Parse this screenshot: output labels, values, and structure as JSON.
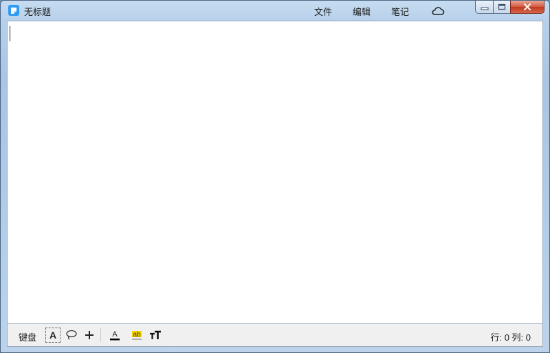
{
  "window": {
    "title": "无标题",
    "menu": {
      "file": "文件",
      "edit": "编辑",
      "notes": "笔记"
    },
    "icons": {
      "app": "note-app-icon",
      "cloud": "cloud-icon",
      "minimize": "minimize-icon",
      "maximize": "maximize-icon",
      "close": "close-icon"
    }
  },
  "editor": {
    "content": ""
  },
  "toolbar": {
    "keyboard_label": "键盘",
    "text_tool_label": "A",
    "font_color_label": "A",
    "highlight_label": "ab",
    "font_color_swatch": "#000000",
    "highlight_color": "#f5d400",
    "icons": {
      "lasso": "lasso-icon",
      "plus": "plus-icon",
      "font_size": "font-size-icon"
    }
  },
  "status": {
    "position": "行: 0 列: 0"
  },
  "colors": {
    "titlebar": "#b7d0ea",
    "close_button": "#c94a2f",
    "app_icon": "#2f9bf2"
  }
}
